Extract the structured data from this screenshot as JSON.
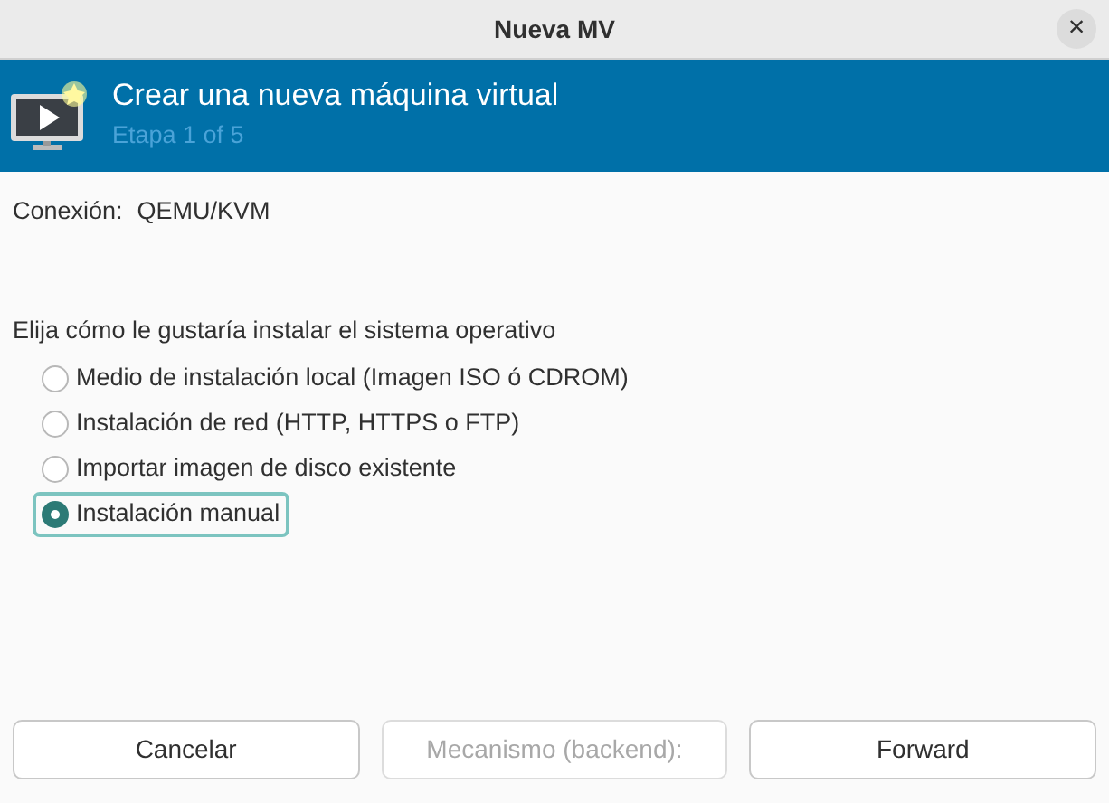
{
  "window": {
    "title": "Nueva MV",
    "close": "×"
  },
  "header": {
    "title": "Crear una nueva máquina virtual",
    "subtitle": "Etapa 1 of 5"
  },
  "connection": {
    "label": "Conexión:",
    "value": "QEMU/KVM"
  },
  "install": {
    "prompt": "Elija cómo le gustaría instalar el sistema operativo",
    "options": [
      {
        "label": "Medio de instalación local (Imagen ISO ó CDROM)",
        "selected": false
      },
      {
        "label": "Instalación de red (HTTP, HTTPS o FTP)",
        "selected": false
      },
      {
        "label": "Importar imagen de disco existente",
        "selected": false
      },
      {
        "label": "Instalación manual",
        "selected": true
      }
    ]
  },
  "buttons": [
    {
      "label": "Cancelar",
      "disabled": false
    },
    {
      "label": "Mecanismo (backend):",
      "disabled": true
    },
    {
      "label": "Forward",
      "disabled": false
    }
  ]
}
